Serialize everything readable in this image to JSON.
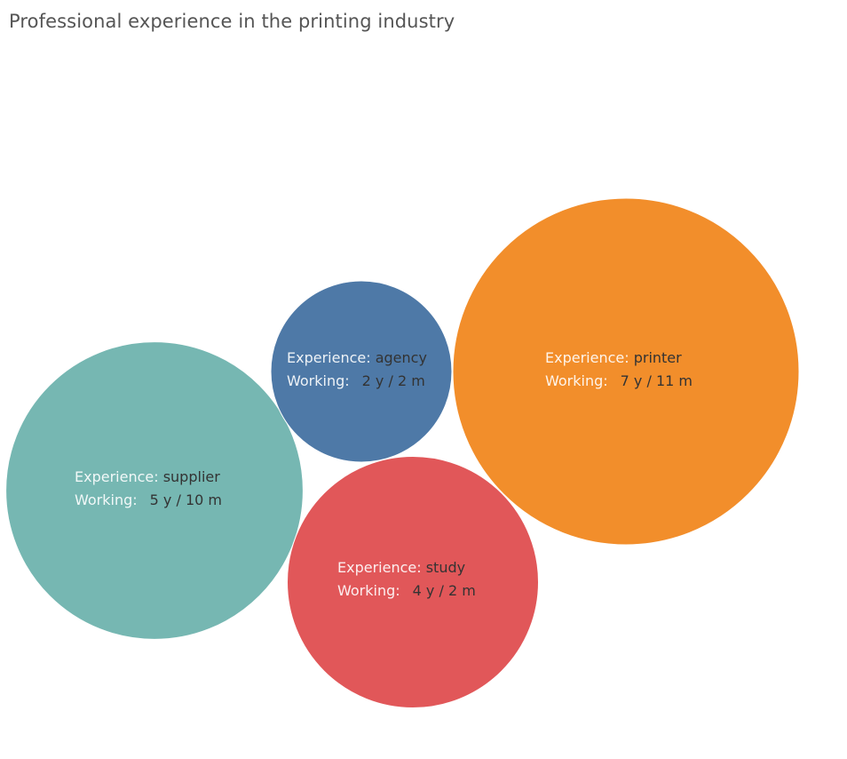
{
  "title": "Professional experience in the printing industry",
  "chart_data": {
    "type": "bubble",
    "title": "Professional experience in the printing industry",
    "field_labels": {
      "experience": "Experience:",
      "working": "Working:"
    },
    "bubbles": [
      {
        "experience": "printer",
        "working": "7 y / 11 m",
        "months": 95,
        "color": "#f28e2b"
      },
      {
        "experience": "supplier",
        "working": "5 y / 10 m",
        "months": 70,
        "color": "#76b7b2"
      },
      {
        "experience": "study",
        "working": "4 y / 2 m",
        "months": 50,
        "color": "#e15759"
      },
      {
        "experience": "agency",
        "working": "2 y / 2 m",
        "months": 26,
        "color": "#4e79a7"
      }
    ]
  }
}
